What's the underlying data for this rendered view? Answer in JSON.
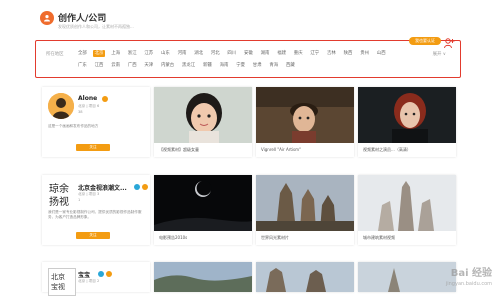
{
  "header": {
    "title": "创作人/公司",
    "subtitle": "发现优质创作人和公司，让素材不再孤独..."
  },
  "filter": {
    "label": "所在地区",
    "more_label": "展开 ∨",
    "row1": [
      "全部",
      "北京",
      "上海",
      "浙江",
      "江苏",
      "山东",
      "河南",
      "湖北",
      "河北",
      "四川",
      "安徽",
      "湖南",
      "福建",
      "重庆",
      "辽宁",
      "吉林",
      "陕西",
      "贵州",
      "山西"
    ],
    "row2": [
      "广东",
      "江西",
      "云南",
      "广西",
      "天津",
      "内蒙古",
      "黑龙江",
      "新疆",
      "海南",
      "宁夏",
      "甘肃",
      "青海",
      "西藏"
    ],
    "active": "北京",
    "cert_button": "我也要认证"
  },
  "creators": [
    {
      "name": "Alone",
      "meta1": "北京 | 项目 6",
      "meta2": "38",
      "desc": "这是一个画画和发布作品的地方",
      "follow": "关注"
    },
    {
      "name": "北京金视浪潮文...",
      "meta1": "北京 | 项目 3",
      "meta2": "1",
      "desc": "我们是一家专业影视制作公司，提供优质的影视作品制作服务，为客户打造品牌形象。",
      "follow": "关注"
    },
    {
      "name": "宝宝",
      "meta1": "北京 | 项目 2",
      "meta2": "",
      "desc": "",
      "follow": "关注"
    }
  ],
  "works": [
    {
      "caption": "【视频素材】超级女童"
    },
    {
      "caption": "Vignrell \"Air Artism\""
    },
    {
      "caption": "【视频素材】少年的成长"
    },
    {
      "caption": "视频素材之演员...（高清）"
    },
    {
      "caption": "电影预告2010s"
    },
    {
      "caption": "世界风光素材片"
    },
    {
      "caption": "城市建筑素材视频"
    },
    {
      "caption": "风景纪实短片"
    }
  ],
  "watermark": "Bai 经验",
  "watermark_url": "jingyan.baidu.com",
  "colors": {
    "accent": "#f39c12",
    "frame": "#e23b2e"
  },
  "icons": [
    "user-icon",
    "verified-icon",
    "follow-person-icon"
  ]
}
